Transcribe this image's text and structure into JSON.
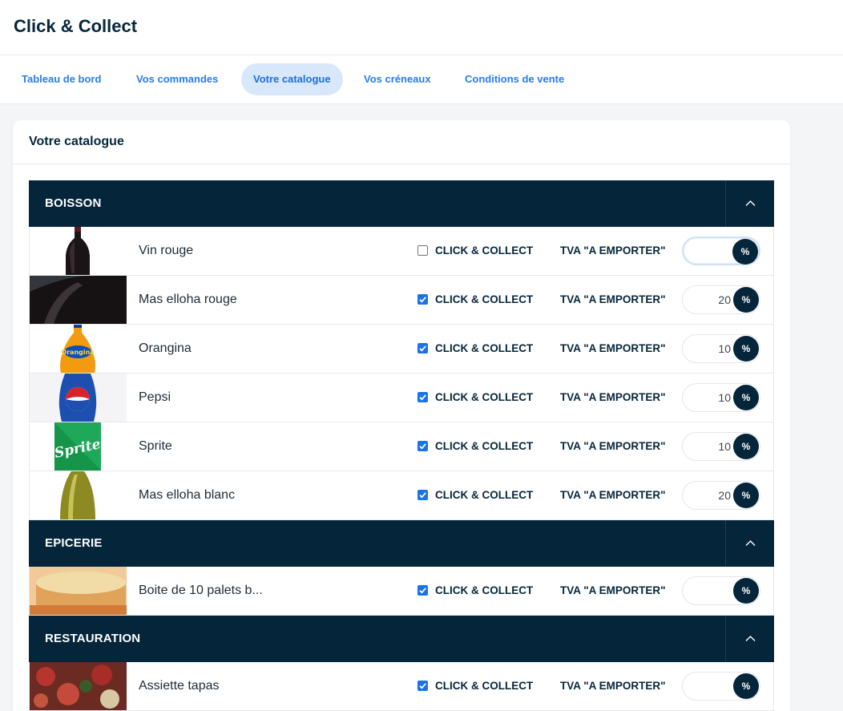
{
  "app": {
    "title": "Click & Collect"
  },
  "tabs": [
    {
      "label": "Tableau de bord",
      "active": false
    },
    {
      "label": "Vos commandes",
      "active": false
    },
    {
      "label": "Votre catalogue",
      "active": true
    },
    {
      "label": "Vos créneaux",
      "active": false
    },
    {
      "label": "Conditions de vente",
      "active": false
    }
  ],
  "card": {
    "title": "Votre catalogue"
  },
  "labels": {
    "click_collect": "CLICK & COLLECT",
    "tva": "TVA \"A EMPORTER\"",
    "percent": "%"
  },
  "colors": {
    "navy": "#05253a",
    "accent": "#1a73e8",
    "tab_active_bg": "#d9e7fb"
  },
  "categories": [
    {
      "name": "BOISSON",
      "products": [
        {
          "name": "Vin rouge",
          "click_collect": false,
          "tva": "",
          "image": "red-wine-bottle"
        },
        {
          "name": "Mas elloha rouge",
          "click_collect": true,
          "tva": "20",
          "image": "red-wine-bottle-closeup"
        },
        {
          "name": "Orangina",
          "click_collect": true,
          "tva": "10",
          "image": "orangina-bottle"
        },
        {
          "name": "Pepsi",
          "click_collect": true,
          "tva": "10",
          "image": "pepsi-bottle"
        },
        {
          "name": "Sprite",
          "click_collect": true,
          "tva": "10",
          "image": "sprite-can"
        },
        {
          "name": "Mas elloha blanc",
          "click_collect": true,
          "tva": "20",
          "image": "white-wine-bottle"
        }
      ]
    },
    {
      "name": "EPICERIE",
      "products": [
        {
          "name": "Boite de 10 palets b...",
          "click_collect": true,
          "tva": "",
          "image": "butter-biscuit"
        }
      ]
    },
    {
      "name": "RESTAURATION",
      "products": [
        {
          "name": "Assiette tapas",
          "click_collect": true,
          "tva": "",
          "image": "tapas-plate"
        }
      ]
    }
  ]
}
